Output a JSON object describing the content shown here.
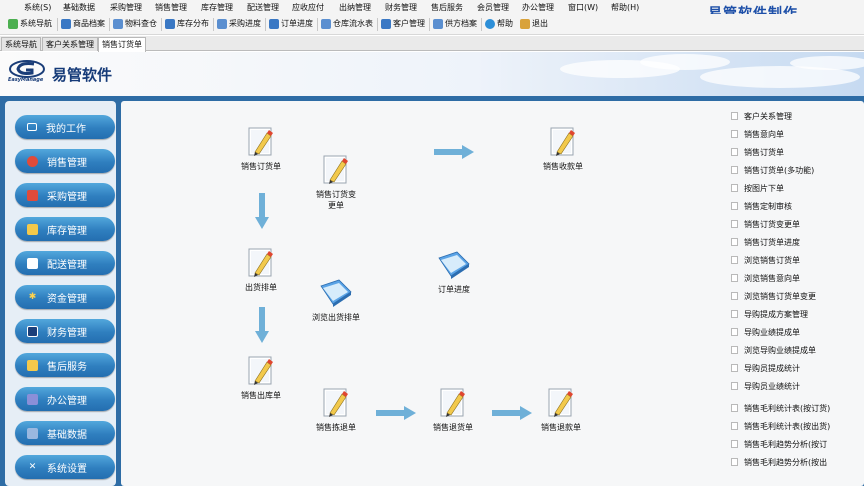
{
  "menu": [
    "系统(S)",
    "基础数据",
    "采购管理",
    "销售管理",
    "库存管理",
    "配送管理",
    "应收应付",
    "出纳管理",
    "财务管理",
    "售后服务",
    "会员管理",
    "办公管理",
    "窗口(W)",
    "帮助(H)"
  ],
  "brand": "易管软件制作",
  "toolbar": [
    "系统导航",
    "商品档案",
    "物料查仓",
    "库存分布",
    "采购进度",
    "订单进度",
    "仓库流水表",
    "客户管理",
    "供方档案",
    "帮助",
    "退出"
  ],
  "tabs": [
    "系统导航",
    "客户关系管理",
    "销售订货单"
  ],
  "logo": {
    "name": "易管软件",
    "sub": "EasyManage"
  },
  "nav": [
    "我的工作",
    "销售管理",
    "采购管理",
    "库存管理",
    "配送管理",
    "资金管理",
    "财务管理",
    "售后服务",
    "办公管理",
    "基础数据",
    "系统设置"
  ],
  "modules": {
    "order": "销售订货单",
    "order_change": "销售订货变更单",
    "receipt": "销售收款单",
    "dispatch": "出货排单",
    "browse_dispatch": "浏览出货排单",
    "order_progress": "订单进度",
    "outbound": "销售出库单",
    "return_pick": "销售拣退单",
    "return": "销售退货单",
    "refund": "销售退款单"
  },
  "right_list": [
    "客户关系管理",
    "销售意向单",
    "销售订货单",
    "销售订货单(多功能)",
    "按图片下单",
    "销售定制审核",
    "销售订货变更单",
    "销售订货单进度",
    "浏览销售订货单",
    "浏览销售意向单",
    "浏览销售订货单变更",
    "导购提成方案管理",
    "导购业绩提成单",
    "浏览导购业绩提成单",
    "导购员提成统计",
    "导购员业绩统计",
    "销售毛利统计表(按订货)",
    "销售毛利统计表(按出货)",
    "销售毛利趋势分析(按订",
    "销售毛利趋势分析(按出"
  ]
}
